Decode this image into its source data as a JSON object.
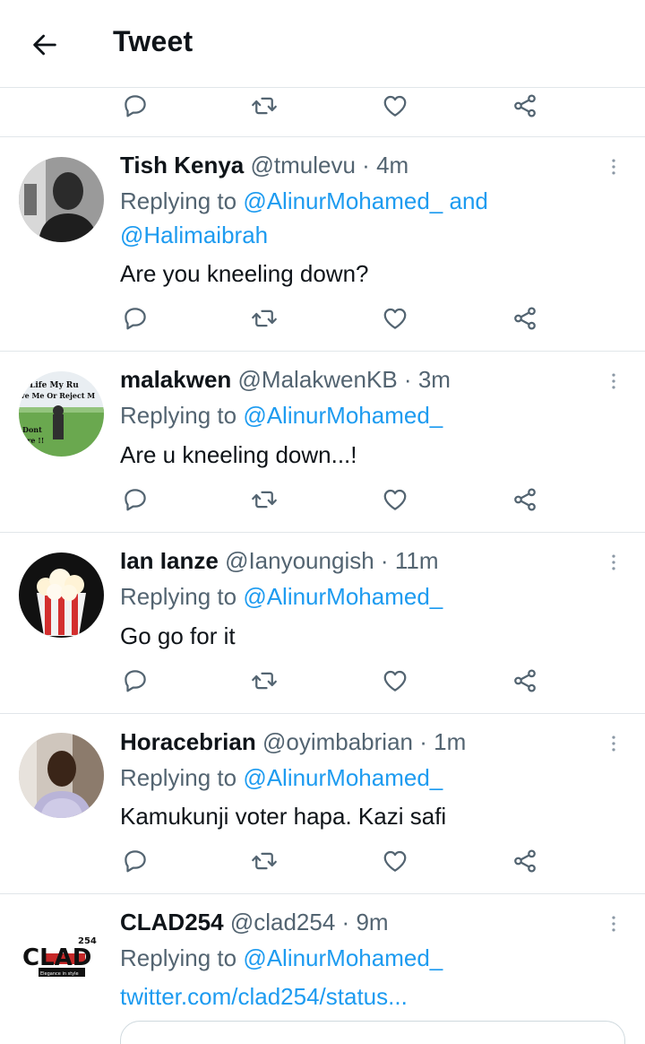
{
  "header": {
    "title": "Tweet"
  },
  "replying_prefix": "Replying to",
  "tweets": [
    {
      "name": "Tish Kenya",
      "handle": "@tmulevu",
      "time": "4m",
      "mention1": "@AlinurMohamed_",
      "joiner": "and",
      "mention2": "@Halimaibrah",
      "text": "Are you kneeling down?"
    },
    {
      "name": "malakwen",
      "handle": "@MalakwenKB",
      "time": "3m",
      "mention1": "@AlinurMohamed_",
      "text": "Are u kneeling  down...!",
      "avatar_text": [
        "Life My Ru",
        "ve Me Or Reject M",
        "Dont",
        "are !!"
      ]
    },
    {
      "name": "Ian Ianze",
      "handle": "@Ianyoungish",
      "time": "11m",
      "mention1": "@AlinurMohamed_",
      "text": "Go go for it"
    },
    {
      "name": "Horacebrian",
      "handle": "@oyimbabrian",
      "time": "1m",
      "mention1": "@AlinurMohamed_",
      "text": "Kamukunji voter hapa. Kazi safi"
    },
    {
      "name": "CLAD254",
      "handle": "@clad254",
      "time": "9m",
      "mention1": "@AlinurMohamed_",
      "link": "twitter.com/clad254/status...",
      "avatar_text": [
        "CLAD",
        "254",
        "Elegance in style"
      ]
    }
  ],
  "icons": {
    "back": "arrow-left-icon",
    "reply": "speech-bubble-icon",
    "retweet": "retweet-icon",
    "like": "heart-icon",
    "share": "share-icon",
    "more": "vertical-dots-icon"
  },
  "colors": {
    "accent": "#1d9bf0",
    "secondary_text": "#536471",
    "primary_text": "#0f1419",
    "divider": "#e1e6ea"
  }
}
